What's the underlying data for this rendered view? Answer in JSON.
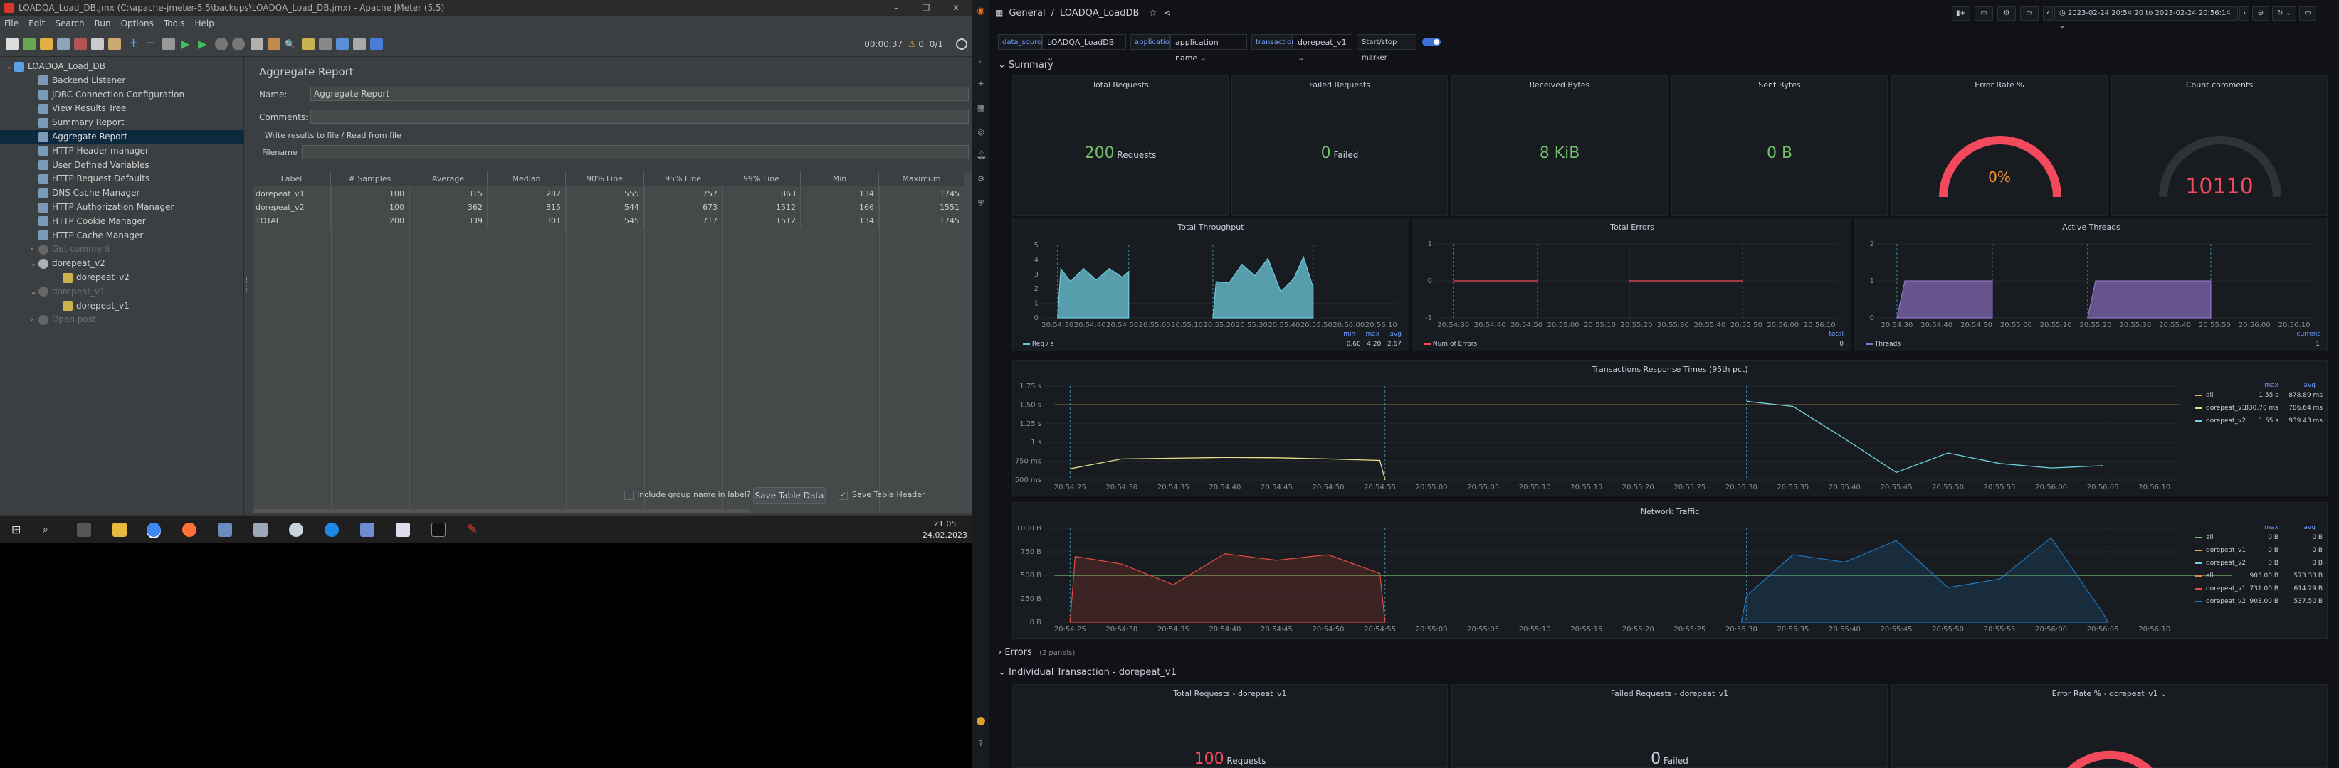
{
  "jmeter": {
    "title": "LOADQA_Load_DB.jmx (C:\\apache-jmeter-5.5\\backups\\LOADQA_Load_DB.jmx) - Apache JMeter (5.5)",
    "menu": [
      "File",
      "Edit",
      "Search",
      "Run",
      "Options",
      "Tools",
      "Help"
    ],
    "timer": "00:00:37",
    "warn_count": "0",
    "threads": "0/1",
    "tree": [
      {
        "label": "LOADQA_Load_DB",
        "depth": 0,
        "kind": "plan",
        "state": "normal"
      },
      {
        "label": "Backend Listener",
        "depth": 1,
        "kind": "config",
        "state": "normal"
      },
      {
        "label": "JDBC Connection Configuration",
        "depth": 1,
        "kind": "config",
        "state": "normal"
      },
      {
        "label": "View Results Tree",
        "depth": 1,
        "kind": "config",
        "state": "normal"
      },
      {
        "label": "Summary Report",
        "depth": 1,
        "kind": "config",
        "state": "normal"
      },
      {
        "label": "Aggregate Report",
        "depth": 1,
        "kind": "config",
        "state": "selected"
      },
      {
        "label": "HTTP Header manager",
        "depth": 1,
        "kind": "config",
        "state": "normal"
      },
      {
        "label": "User Defined Variables",
        "depth": 1,
        "kind": "config",
        "state": "normal"
      },
      {
        "label": "HTTP Request Defaults",
        "depth": 1,
        "kind": "config",
        "state": "normal"
      },
      {
        "label": "DNS Cache Manager",
        "depth": 1,
        "kind": "config",
        "state": "normal"
      },
      {
        "label": "HTTP Authorization Manager",
        "depth": 1,
        "kind": "config",
        "state": "normal"
      },
      {
        "label": "HTTP Cookie Manager",
        "depth": 1,
        "kind": "config",
        "state": "normal"
      },
      {
        "label": "HTTP Cache Manager",
        "depth": 1,
        "kind": "config",
        "state": "normal"
      },
      {
        "label": "Get comment",
        "depth": 1,
        "kind": "group",
        "state": "disabled"
      },
      {
        "label": "dorepeat_v2",
        "depth": 1,
        "kind": "group",
        "state": "normal"
      },
      {
        "label": "dorepeat_v2",
        "depth": 2,
        "kind": "sampler",
        "state": "normal"
      },
      {
        "label": "dorepeat_v1",
        "depth": 1,
        "kind": "group",
        "state": "disabled"
      },
      {
        "label": "dorepeat_v1",
        "depth": 2,
        "kind": "sampler",
        "state": "normal"
      },
      {
        "label": "Open post",
        "depth": 1,
        "kind": "group",
        "state": "disabled"
      }
    ],
    "panel": {
      "heading": "Aggregate Report",
      "name_label": "Name:",
      "name_value": "Aggregate Report",
      "comments_label": "Comments:",
      "write_results": "Write results to file / Read from file",
      "filename_label": "Filename"
    },
    "table": {
      "headers": [
        "Label",
        "# Samples",
        "Average",
        "Median",
        "90% Line",
        "95% Line",
        "99% Line",
        "Min",
        "Maximum"
      ],
      "rows": [
        [
          "dorepeat_v1",
          "100",
          "315",
          "282",
          "555",
          "757",
          "863",
          "134",
          "1745"
        ],
        [
          "dorepeat_v2",
          "100",
          "362",
          "315",
          "544",
          "673",
          "1512",
          "166",
          "1551"
        ],
        [
          "TOTAL",
          "200",
          "339",
          "301",
          "545",
          "717",
          "1512",
          "134",
          "1745"
        ]
      ]
    },
    "include_group_label": "Include group name in label?",
    "save_table_button": "Save Table Data",
    "save_header_label": "Save Table Header",
    "clock_time": "21:05",
    "clock_date": "24.02.2023"
  },
  "grafana": {
    "breadcrumb_root": "General",
    "breadcrumb_sep": "/",
    "dashboard_title": "LOADQA_LoadDB",
    "time_range": "2023-02-24 20:54:20 to 2023-02-24 20:56:14",
    "vars": [
      {
        "label": "data_source",
        "value": "LOADQA_LoadDB"
      },
      {
        "label": "application",
        "value": "application name"
      },
      {
        "label": "transaction",
        "value": "dorepeat_v1"
      }
    ],
    "start_stop_label": "Start/stop marker",
    "summary_row": "Summary",
    "errors_row": "Errors",
    "errors_panels": "(2 panels)",
    "individual_row": "Individual Transaction - dorepeat_v1",
    "stats": [
      {
        "title": "Total Requests",
        "value": "200",
        "unit": "Requests"
      },
      {
        "title": "Failed Requests",
        "value": "0",
        "unit": "Failed"
      },
      {
        "title": "Received Bytes",
        "value": "8 KiB",
        "unit": ""
      },
      {
        "title": "Sent Bytes",
        "value": "0 B",
        "unit": ""
      }
    ],
    "gauges": [
      {
        "title": "Error Rate %",
        "value": "0%",
        "color": "#f2495c"
      },
      {
        "title": "Count comments",
        "value": "10110",
        "color": "#f2495c"
      }
    ],
    "individual_stats": [
      {
        "title": "Total Requests - dorepeat_v1",
        "value": "100",
        "unit": "Requests"
      },
      {
        "title": "Failed Requests - dorepeat_v1",
        "value": "0",
        "unit": "Failed"
      },
      {
        "title": "Error Rate % - dorepeat_v1",
        "value": "",
        "unit": ""
      }
    ],
    "colors": {
      "green": "#73bf69",
      "red": "#f2495c",
      "cyan": "#5794f2"
    }
  },
  "chart_data": [
    {
      "type": "area",
      "title": "Total Throughput",
      "x": [
        "20:54:30",
        "20:54:40",
        "20:54:50",
        "20:55:00",
        "20:55:10",
        "20:55:20",
        "20:55:30",
        "20:55:40",
        "20:55:50",
        "20:56:00",
        "20:56:10"
      ],
      "ylim": [
        0,
        5
      ],
      "yticks": [
        "0",
        "1",
        "2",
        "3",
        "4",
        "5"
      ],
      "series": [
        {
          "name": "Req / s",
          "color": "#6ccadc",
          "segments": [
            [
              [
                0.0,
                0
              ],
              [
                0.1,
                3.4
              ],
              [
                0.4,
                2.5
              ],
              [
                0.8,
                3.4
              ],
              [
                1.2,
                2.6
              ],
              [
                1.6,
                3.4
              ],
              [
                2.0,
                2.8
              ],
              [
                2.2,
                3.2
              ],
              [
                2.2,
                0
              ]
            ],
            [
              [
                4.8,
                0
              ],
              [
                4.9,
                2.5
              ],
              [
                5.3,
                2.4
              ],
              [
                5.7,
                3.7
              ],
              [
                6.1,
                2.9
              ],
              [
                6.5,
                4.1
              ],
              [
                6.9,
                1.8
              ],
              [
                7.3,
                2.7
              ],
              [
                7.6,
                4.2
              ],
              [
                7.9,
                2.1
              ],
              [
                7.9,
                0
              ]
            ]
          ],
          "min": "0.60",
          "max": "4.20",
          "avg": "2.67"
        }
      ]
    },
    {
      "type": "line",
      "title": "Total Errors",
      "x": [
        "20:54:30",
        "20:54:40",
        "20:54:50",
        "20:55:00",
        "20:55:10",
        "20:55:20",
        "20:55:30",
        "20:55:40",
        "20:55:50",
        "20:56:00",
        "20:56:10"
      ],
      "ylim": [
        -1,
        1
      ],
      "yticks": [
        "-1",
        "0",
        "1"
      ],
      "series": [
        {
          "name": "Num of Errors",
          "color": "#f2495c",
          "segments": [
            [
              [
                0,
                0
              ],
              [
                2.3,
                0
              ]
            ],
            [
              [
                4.8,
                0
              ],
              [
                7.9,
                0
              ]
            ]
          ],
          "total": "0"
        }
      ]
    },
    {
      "type": "area",
      "title": "Active Threads",
      "x": [
        "20:54:30",
        "20:54:40",
        "20:54:50",
        "20:55:00",
        "20:55:10",
        "20:55:20",
        "20:55:30",
        "20:55:40",
        "20:55:50",
        "20:56:00",
        "20:56:10"
      ],
      "ylim": [
        0,
        2
      ],
      "yticks": [
        "0",
        "1",
        "2"
      ],
      "series": [
        {
          "name": "Threads",
          "color": "#8f74c8",
          "segments": [
            [
              [
                0,
                0
              ],
              [
                0.2,
                1
              ],
              [
                2.4,
                1
              ],
              [
                2.4,
                0
              ]
            ],
            [
              [
                4.8,
                0
              ],
              [
                5.0,
                1
              ],
              [
                7.9,
                1
              ],
              [
                7.9,
                0
              ]
            ]
          ],
          "current": "1"
        }
      ]
    },
    {
      "type": "line",
      "title": "Transactions Response Times (95th pct)",
      "x": [
        "20:54:25",
        "20:54:30",
        "20:54:35",
        "20:54:40",
        "20:54:45",
        "20:54:50",
        "20:54:55",
        "20:55:00",
        "20:55:05",
        "20:55:10",
        "20:55:15",
        "20:55:20",
        "20:55:25",
        "20:55:30",
        "20:55:35",
        "20:55:40",
        "20:55:45",
        "20:55:50",
        "20:55:55",
        "20:56:00",
        "20:56:05",
        "20:56:10"
      ],
      "ylim": [
        500,
        1750
      ],
      "yticks": [
        "500 ms",
        "750 ms",
        "1 s",
        "1.25 s",
        "1.50 s",
        "1.75 s"
      ],
      "series": [
        {
          "name": "all",
          "color": "#eab839",
          "max": "1.55 s",
          "avg": "878.89 ms",
          "segments": [
            [
              [
                -0.3,
                1500
              ],
              [
                21.5,
                1500
              ]
            ]
          ]
        },
        {
          "name": "dorepeat_v1",
          "color": "#e5e08b",
          "max": "830.70 ms",
          "avg": "786.64 ms",
          "segments": [
            [
              [
                0,
                650
              ],
              [
                1,
                780
              ],
              [
                2,
                790
              ],
              [
                3,
                800
              ],
              [
                4,
                795
              ],
              [
                5,
                780
              ],
              [
                6,
                760
              ],
              [
                6.1,
                500
              ]
            ]
          ]
        },
        {
          "name": "dorepeat_v2",
          "color": "#6ed0e0",
          "max": "1.55 s",
          "avg": "939.43 ms",
          "segments": [
            [
              [
                13.1,
                1550
              ],
              [
                13.2,
                1540
              ],
              [
                14,
                1480
              ],
              [
                15,
                1050
              ],
              [
                16,
                600
              ],
              [
                17,
                860
              ],
              [
                18,
                720
              ],
              [
                19,
                660
              ],
              [
                20,
                690
              ]
            ]
          ]
        }
      ]
    },
    {
      "type": "area",
      "title": "Network Traffic",
      "x": [
        "20:54:25",
        "20:54:30",
        "20:54:35",
        "20:54:40",
        "20:54:45",
        "20:54:50",
        "20:54:55",
        "20:55:00",
        "20:55:05",
        "20:55:10",
        "20:55:15",
        "20:55:20",
        "20:55:25",
        "20:55:30",
        "20:55:35",
        "20:55:40",
        "20:55:45",
        "20:55:50",
        "20:55:55",
        "20:56:00",
        "20:56:05",
        "20:56:10"
      ],
      "ylim": [
        0,
        1000
      ],
      "yticks": [
        "0 B",
        "250 B",
        "500 B",
        "750 B",
        "1000 B"
      ],
      "series": [
        {
          "name": "all",
          "color": "#73bf69",
          "max": "0 B",
          "avg": "0 B",
          "segments": [
            [
              [
                -0.3,
                500
              ],
              [
                22.5,
                500
              ]
            ]
          ]
        },
        {
          "name": "dorepeat_v1",
          "color": "#eab839",
          "max": "0 B",
          "avg": "0 B",
          "segments": []
        },
        {
          "name": "dorepeat_v2",
          "color": "#6ed0e0",
          "max": "0 B",
          "avg": "0 B",
          "segments": []
        },
        {
          "name": "all",
          "color": "#ef843c",
          "max": "903.00 B",
          "avg": "573.33 B",
          "segments": []
        },
        {
          "name": "dorepeat_v1",
          "color": "#e24d42",
          "max": "731.00 B",
          "avg": "614.29 B",
          "segments": [
            [
              [
                0,
                0
              ],
              [
                0.1,
                700
              ],
              [
                1,
                620
              ],
              [
                2,
                400
              ],
              [
                3,
                730
              ],
              [
                4,
                660
              ],
              [
                5,
                720
              ],
              [
                6,
                520
              ],
              [
                6.1,
                0
              ]
            ]
          ]
        },
        {
          "name": "dorepeat_v2",
          "color": "#1f78c1",
          "max": "903.00 B",
          "avg": "537.50 B",
          "segments": [
            [
              [
                13,
                0
              ],
              [
                13.1,
                280
              ],
              [
                14,
                720
              ],
              [
                15,
                640
              ],
              [
                16,
                870
              ],
              [
                17,
                370
              ],
              [
                18,
                460
              ],
              [
                19,
                900
              ],
              [
                20,
                100
              ],
              [
                20.1,
                0
              ]
            ]
          ]
        }
      ]
    }
  ]
}
